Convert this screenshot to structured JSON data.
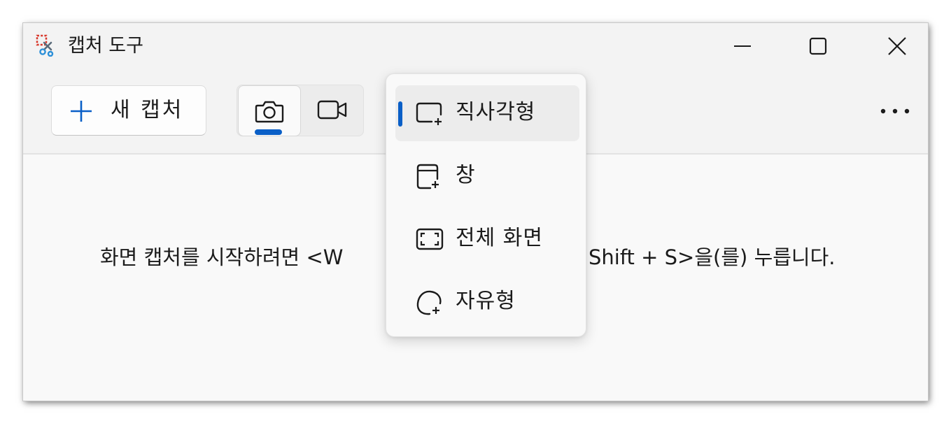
{
  "window": {
    "title": "캡처 도구"
  },
  "title_controls": {
    "minimize_icon": "minimize-icon",
    "maximize_icon": "maximize-icon",
    "close_icon": "close-icon"
  },
  "toolbar": {
    "new_capture_label": "새 캡처",
    "modes": [
      {
        "name": "photo",
        "icon": "camera-icon",
        "selected": true
      },
      {
        "name": "video",
        "icon": "video-camera-icon",
        "selected": false
      }
    ],
    "more_icon": "more-icon"
  },
  "main": {
    "hint_start": "화면 캡처를 시작하려면 <W",
    "hint_end": "Shift + S>을(를) 누릅니다."
  },
  "snip_menu": {
    "items": [
      {
        "label": "직사각형",
        "icon": "rectangle-snip-icon",
        "selected": true
      },
      {
        "label": "창",
        "icon": "window-snip-icon",
        "selected": false
      },
      {
        "label": "전체 화면",
        "icon": "fullscreen-snip-icon",
        "selected": false
      },
      {
        "label": "자유형",
        "icon": "freeform-snip-icon",
        "selected": false
      }
    ]
  },
  "colors": {
    "accent": "#0a5fc7",
    "window_bg": "#f9f9f9",
    "chrome_bg": "#f3f3f3",
    "text": "#1b1b1b"
  }
}
